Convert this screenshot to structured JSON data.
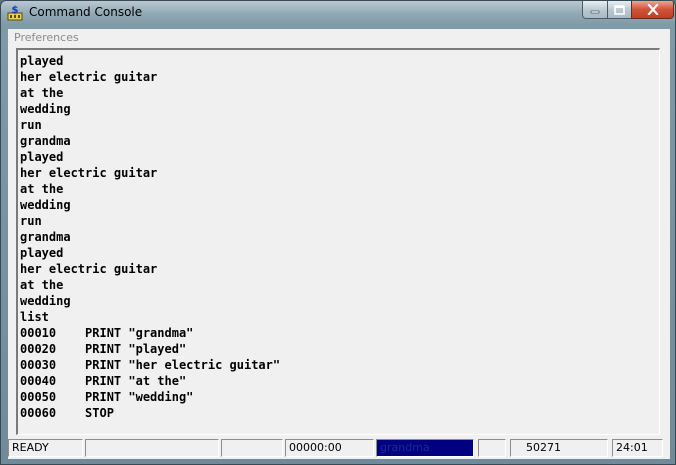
{
  "window": {
    "title": "Command Console",
    "icon": "console-dollar-icon"
  },
  "menu": {
    "items": [
      "Preferences"
    ]
  },
  "console": {
    "lines": [
      "played",
      "her electric guitar",
      "at the",
      "wedding",
      "run",
      "grandma",
      "played",
      "her electric guitar",
      "at the",
      "wedding",
      "run",
      "grandma",
      "played",
      "her electric guitar",
      "at the",
      "wedding",
      "list",
      "00010    PRINT \"grandma\"",
      "00020    PRINT \"played\"",
      "00030    PRINT \"her electric guitar\"",
      "00040    PRINT \"at the\"",
      "00050    PRINT \"wedding\"",
      "00060    STOP"
    ]
  },
  "status": {
    "state": "READY",
    "panel2": "",
    "panel3": "",
    "timer": "00000:00",
    "program_name": "grandma",
    "panel6": "",
    "bytes_free": "50271",
    "clock": "24:01"
  },
  "colors": {
    "status_highlight": "#000080",
    "console_background": "#f0f0f0"
  }
}
